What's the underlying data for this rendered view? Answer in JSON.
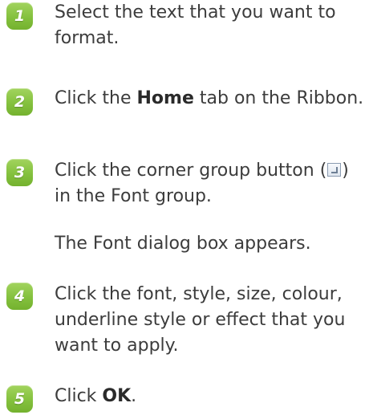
{
  "steps": [
    {
      "number": "1",
      "text": "Select the text that you want to format."
    },
    {
      "number": "2",
      "before": "Click the ",
      "bold": "Home",
      "after": " tab on the Ribbon."
    },
    {
      "number": "3",
      "before": "Click the corner group button (",
      "icon": "dialog-launcher-icon",
      "after": ") in the Font group."
    },
    {
      "number": "4",
      "text": "Click the font, style, size, colour, underline style or effect that you want to apply."
    },
    {
      "number": "5",
      "before": "Click ",
      "bold": "OK",
      "after": "."
    }
  ],
  "note": "The Font dialog box appears.",
  "colors": {
    "badge": "#84c13e",
    "text": "#3c3c3c"
  }
}
